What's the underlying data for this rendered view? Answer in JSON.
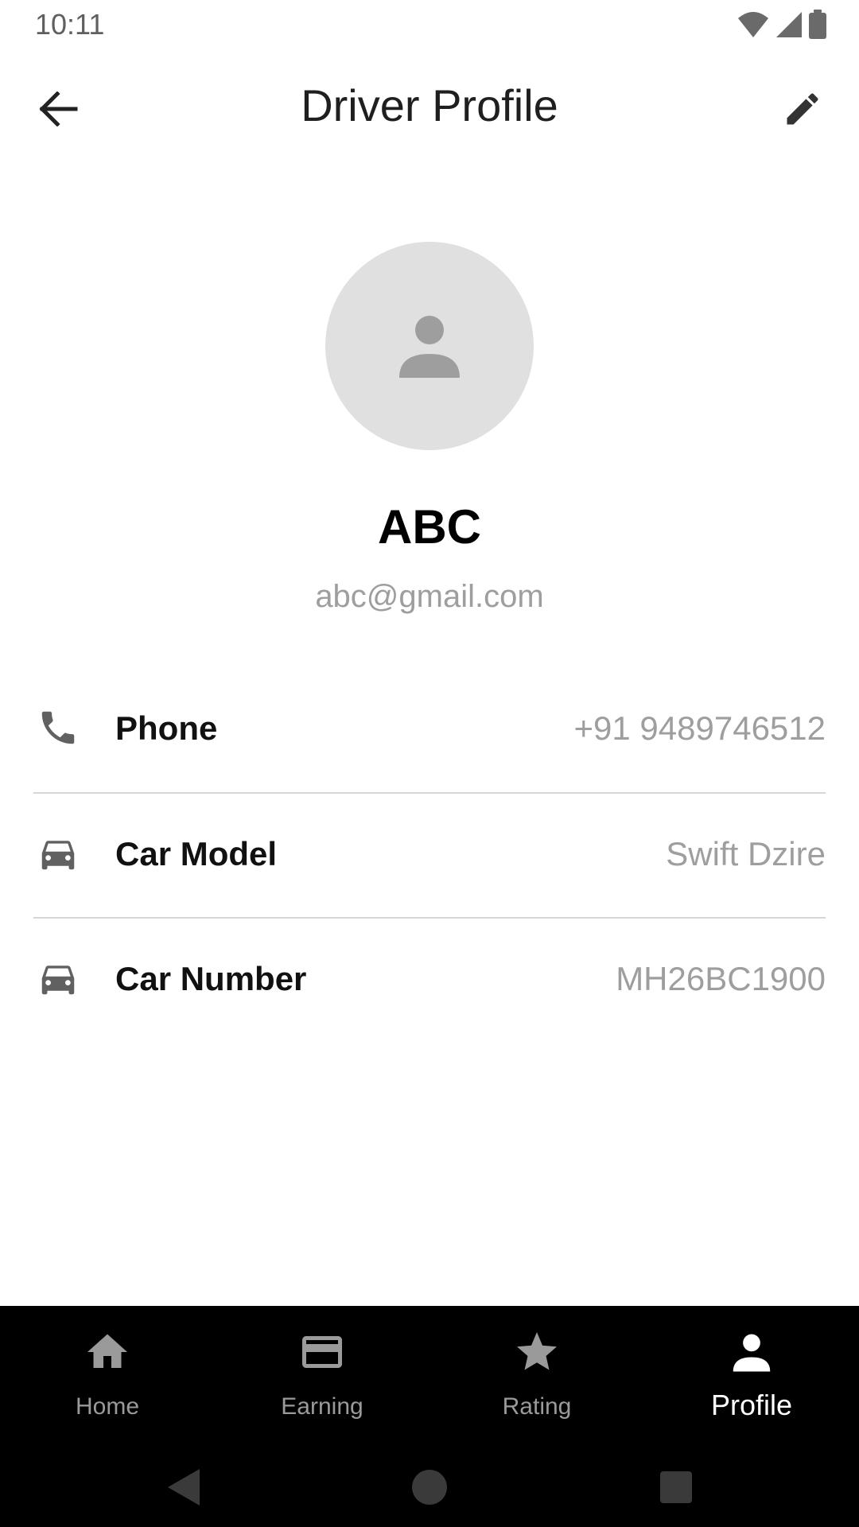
{
  "status_bar": {
    "time": "10:11"
  },
  "header": {
    "title": "Driver Profile"
  },
  "profile": {
    "name": "ABC",
    "email": "abc@gmail.com"
  },
  "info": [
    {
      "icon": "phone-icon",
      "label": "Phone",
      "value": "+91 9489746512"
    },
    {
      "icon": "car-icon",
      "label": "Car Model",
      "value": "Swift Dzire"
    },
    {
      "icon": "car-icon",
      "label": "Car Number",
      "value": "MH26BC1900"
    }
  ],
  "bottom_nav": [
    {
      "icon": "home-icon",
      "label": "Home"
    },
    {
      "icon": "card-icon",
      "label": "Earning"
    },
    {
      "icon": "star-icon",
      "label": "Rating"
    },
    {
      "icon": "person-icon",
      "label": "Profile",
      "active": true
    }
  ],
  "colors": {
    "icon_gray": "#616161",
    "text_muted": "#9e9e9e",
    "nav_bg": "#000000",
    "avatar_bg": "#e0e0e0"
  }
}
